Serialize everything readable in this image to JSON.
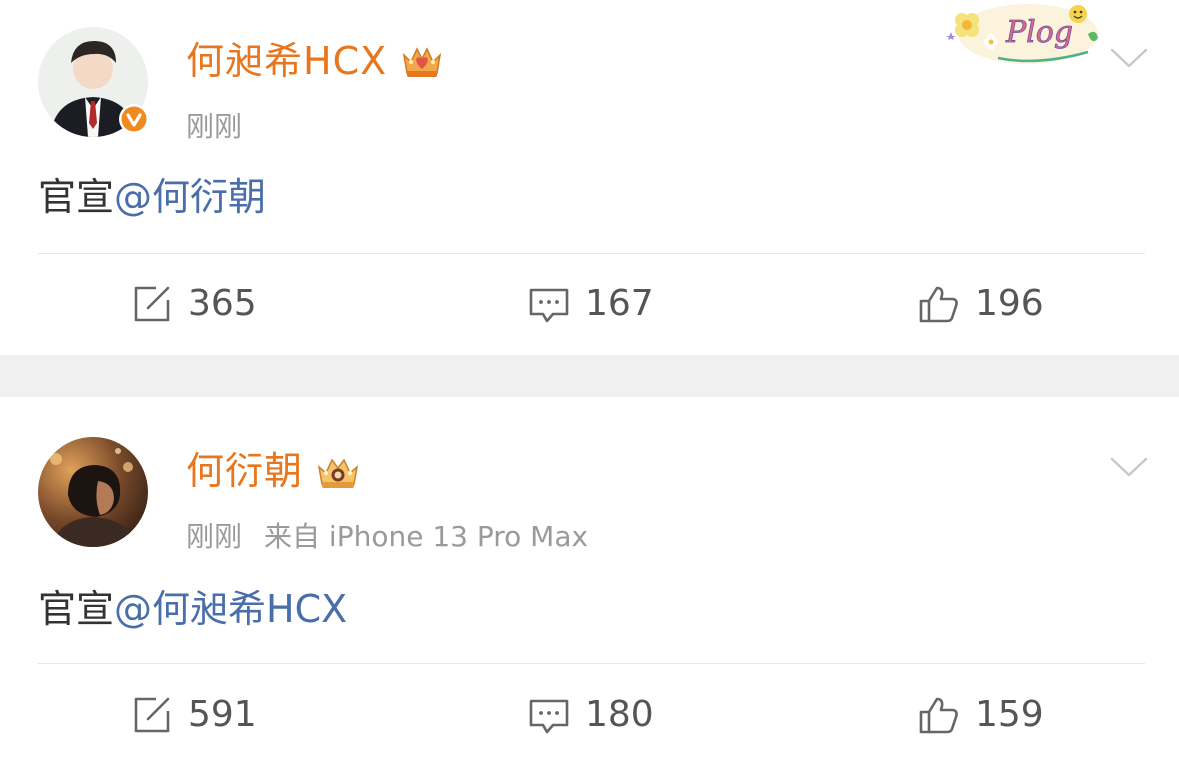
{
  "posts": [
    {
      "username": "何昶希HCX",
      "time": "刚刚",
      "source": "",
      "content_prefix": "官宣",
      "content_mention": "@何衍朝",
      "reposts": "365",
      "comments": "167",
      "likes": "196",
      "sticker_text": "Plog",
      "verified": true
    },
    {
      "username": "何衍朝",
      "time": "刚刚",
      "source": "来自 iPhone 13 Pro Max",
      "content_prefix": "官宣",
      "content_mention": "@何昶希HCX",
      "reposts": "591",
      "comments": "180",
      "likes": "159",
      "verified": false
    }
  ],
  "colors": {
    "username": "#e8761f",
    "mention": "#4a6ea9",
    "meta": "#9a9a9a",
    "separator": "#f0f0f0",
    "verified_badge": "#f08a1e"
  },
  "icons": {
    "repost": "repost-icon",
    "comment": "comment-icon",
    "like": "thumbs-up-icon",
    "menu": "chevron-down-icon",
    "crown": "crown-badge-icon"
  }
}
